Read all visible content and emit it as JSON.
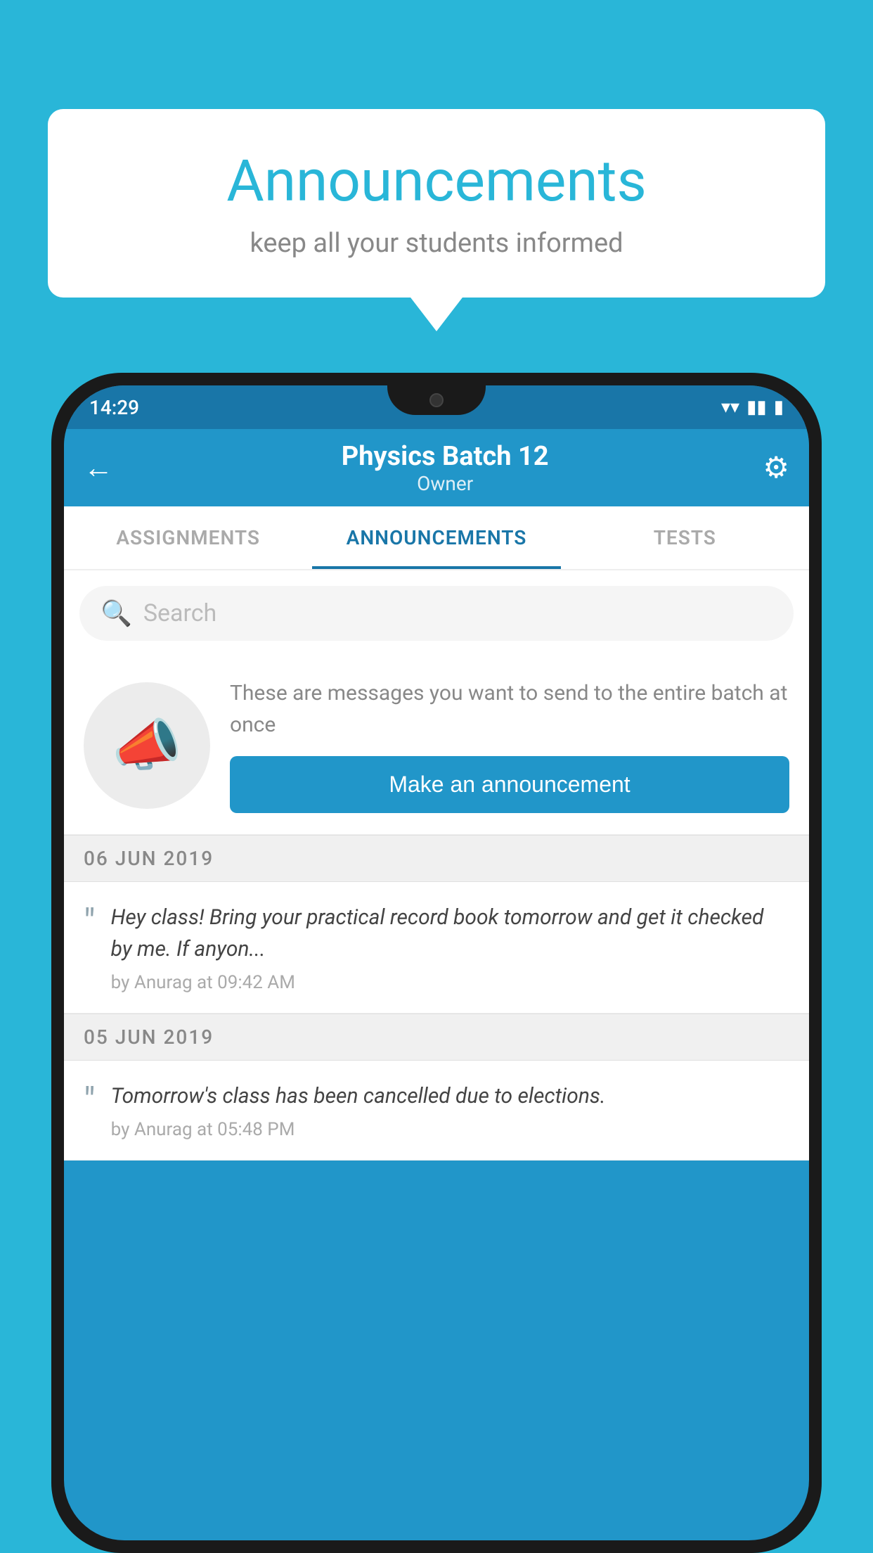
{
  "bubble": {
    "title": "Announcements",
    "subtitle": "keep all your students informed"
  },
  "phone": {
    "statusBar": {
      "time": "14:29",
      "icons": [
        "▾",
        "◂",
        "▮"
      ]
    },
    "appBar": {
      "title": "Physics Batch 12",
      "subtitle": "Owner",
      "backLabel": "←",
      "gearLabel": "⚙"
    },
    "tabs": [
      {
        "label": "ASSIGNMENTS",
        "active": false
      },
      {
        "label": "ANNOUNCEMENTS",
        "active": true
      },
      {
        "label": "TESTS",
        "active": false
      }
    ],
    "search": {
      "placeholder": "Search"
    },
    "promo": {
      "description": "These are messages you want to send to the entire batch at once",
      "buttonLabel": "Make an announcement"
    },
    "announcements": [
      {
        "date": "06  JUN  2019",
        "message": "Hey class! Bring your practical record book tomorrow and get it checked by me. If anyon...",
        "meta": "by Anurag at 09:42 AM"
      },
      {
        "date": "05  JUN  2019",
        "message": "Tomorrow's class has been cancelled due to elections.",
        "meta": "by Anurag at 05:48 PM"
      }
    ]
  }
}
